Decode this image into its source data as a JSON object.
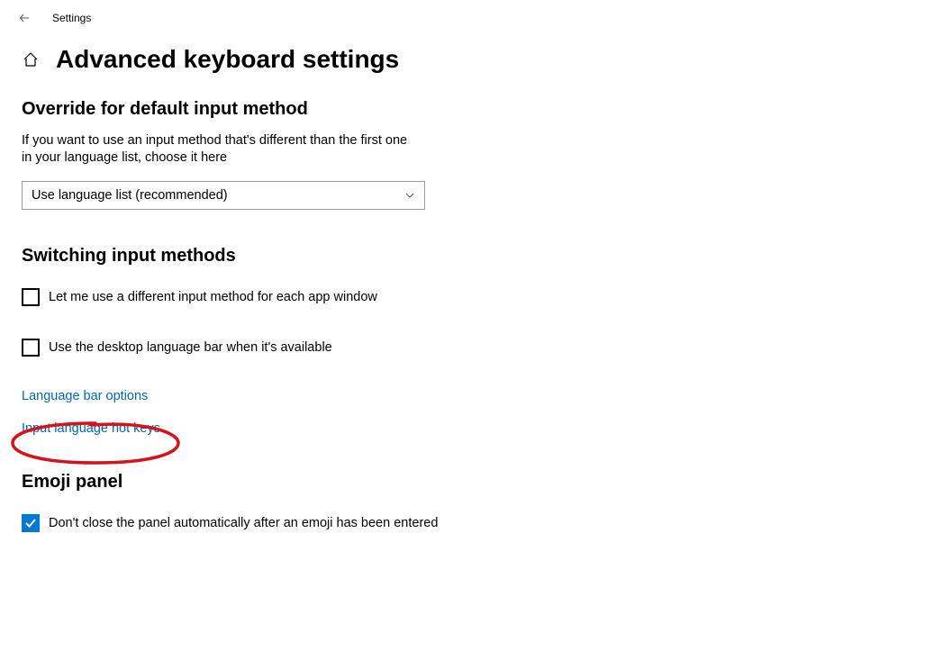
{
  "titlebar": {
    "app_name": "Settings"
  },
  "header": {
    "page_title": "Advanced keyboard settings"
  },
  "sections": {
    "override": {
      "title": "Override for default input method",
      "description": "If you want to use an input method that's different than the first one in your language list, choose it here",
      "dropdown_value": "Use language list (recommended)"
    },
    "switching": {
      "title": "Switching input methods",
      "checkbox1_label": "Let me use a different input method for each app window",
      "checkbox1_checked": false,
      "checkbox2_label": "Use the desktop language bar when it's available",
      "checkbox2_checked": false,
      "link1": "Language bar options",
      "link2": "Input language hot keys"
    },
    "emoji": {
      "title": "Emoji panel",
      "checkbox_label": "Don't close the panel automatically after an emoji has been entered",
      "checkbox_checked": true
    }
  }
}
